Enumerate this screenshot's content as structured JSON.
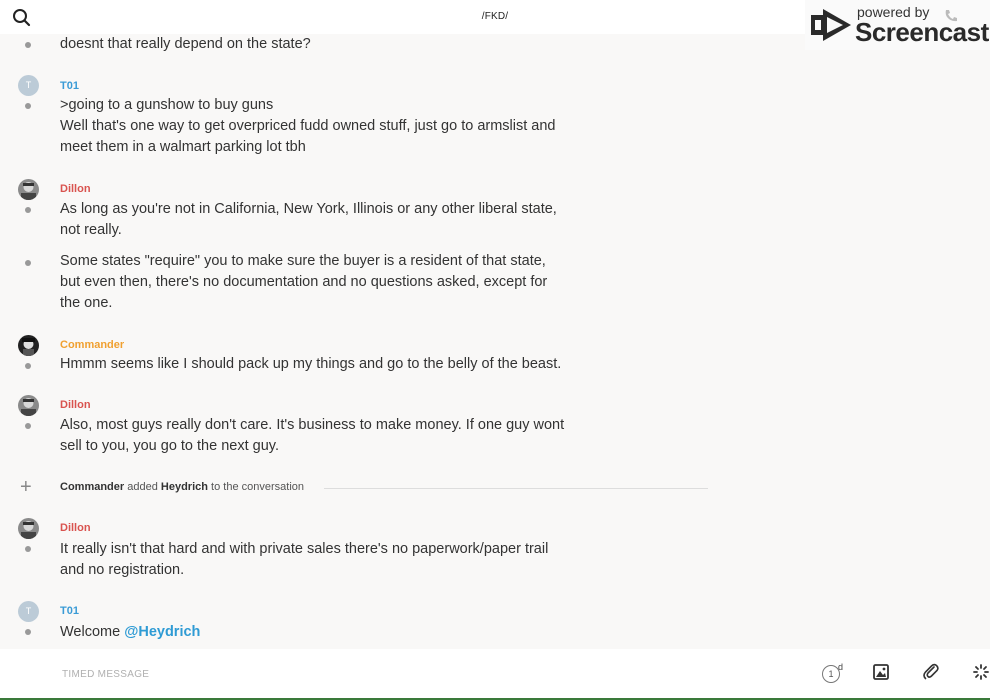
{
  "header": {
    "title": "/FKD/",
    "search_icon": "search-icon"
  },
  "watermark": {
    "powered_by": "powered by",
    "brand": "Screencastify"
  },
  "messages": [
    {
      "text": "doesnt that really depend on the state?"
    },
    {
      "author": "T01",
      "avatar_letter": "T",
      "lines": [
        ">going to a gunshow to buy guns",
        "Well that's one way to get overpriced fudd owned stuff, just go to armslist and meet them in a walmart parking lot tbh"
      ]
    },
    {
      "author": "Dillon",
      "text": "As long as you're not in California, New York, Illinois or any other liberal state, not really."
    },
    {
      "text": "Some states \"require\" you to make sure the buyer is a resident of that state, but even then, there's no documentation and no questions asked, except for the one."
    },
    {
      "author": "Commander",
      "text": "Hmmm seems like I should pack up my things and go to the belly of the beast."
    },
    {
      "author": "Dillon",
      "text": "Also, most guys really don't care. It's business to make money. If one guy wont sell to you, you go to the next guy."
    },
    {
      "author": "Dillon",
      "text": "It really isn't that hard and with private sales there's no paperwork/paper trail and no registration."
    },
    {
      "author": "T01",
      "avatar_letter": "T",
      "text_prefix": "Welcome ",
      "mention": "@Heydrich"
    }
  ],
  "system_event": {
    "actor": "Commander",
    "action": "added",
    "target": "Heydrich",
    "suffix": "to the conversation"
  },
  "composer": {
    "placeholder": "TIMED MESSAGE",
    "timer_value": "1",
    "timer_unit": "d"
  },
  "colors": {
    "t01": "#3a9bd6",
    "dillon": "#d9534f",
    "commander": "#f0a030",
    "mention": "#2f9bd4"
  }
}
